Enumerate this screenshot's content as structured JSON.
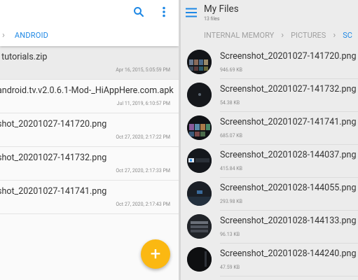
{
  "left": {
    "breadcrumb_active": "ANDROID",
    "files": [
      {
        "name": "l tutorials.zip",
        "date": "Apr 16, 2015, 5:05:59 PM"
      },
      {
        "name": "android.tv.v2.0.6.1-Mod-_HiAppHere.com.apk",
        "date": "Jul 11, 2019, 6:10:57 PM"
      },
      {
        "name": "shot_20201027-141720.png",
        "date": "Oct 27, 2020, 2:17:22 PM"
      },
      {
        "name": "shot_20201027-141732.png",
        "date": "Oct 27, 2020, 2:17:33 PM"
      },
      {
        "name": "shot_20201027-141741.png",
        "date": "Oct 27, 2020, 2:17:43 PM"
      }
    ],
    "fab_label": "+"
  },
  "right": {
    "title": "My Files",
    "subtitle": "13 files",
    "breadcrumbs": [
      "INTERNAL MEMORY",
      "PICTURES",
      "SC"
    ],
    "files": [
      {
        "name": "Screenshot_20201027-141720.png",
        "size": "946.69 KB"
      },
      {
        "name": "Screenshot_20201027-141732.png",
        "size": "54.38 KB"
      },
      {
        "name": "Screenshot_20201027-141741.png",
        "size": "685.07 KB"
      },
      {
        "name": "Screenshot_20201028-144037.png",
        "size": "415.84 KB"
      },
      {
        "name": "Screenshot_20201028-144055.png",
        "size": "293.98 KB"
      },
      {
        "name": "Screenshot_20201028-144133.png",
        "size": "96.13 KB"
      },
      {
        "name": "Screenshot_20201028-144240.png",
        "size": "47.59 KB"
      }
    ]
  },
  "colors": {
    "accent": "#1e88e5",
    "fab": "#fbb812"
  },
  "icons": {
    "search": "search-icon",
    "more": "more-vert-icon",
    "menu": "menu-icon"
  }
}
